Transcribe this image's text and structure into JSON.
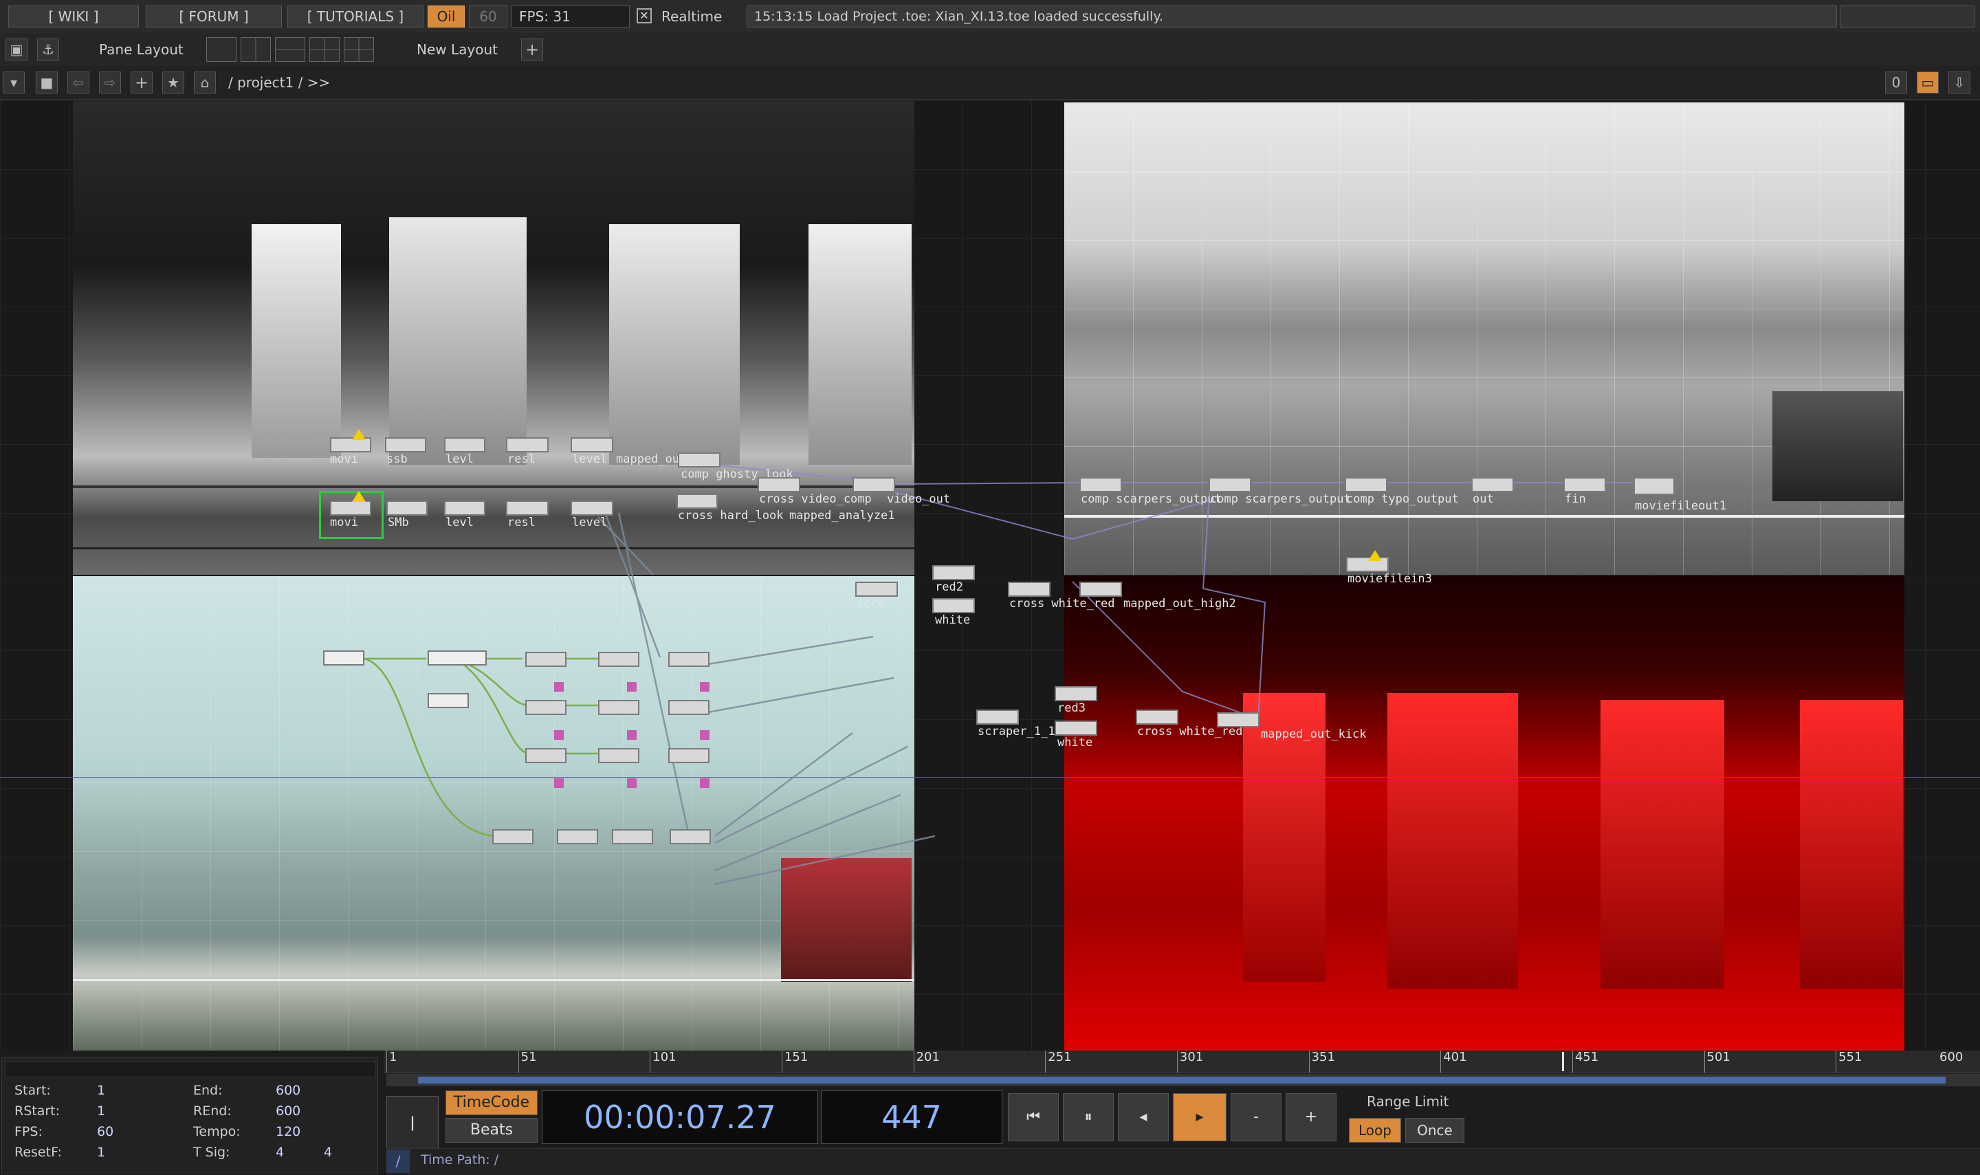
{
  "topbar": {
    "wiki": "[ WIKI ]",
    "forum": "[ FORUM ]",
    "tutorials": "[ TUTORIALS ]",
    "oil": "Oil",
    "sixty": "60",
    "fps": "FPS:  31",
    "realtime": "Realtime",
    "status": "15:13:15 Load Project .toe: Xian_XI.13.toe loaded successfully."
  },
  "row2": {
    "pane_layout": "Pane Layout",
    "new_layout": "New Layout"
  },
  "row3": {
    "path": "/ project1  / >>",
    "counter": "0"
  },
  "nodes": {
    "r1": [
      "movi",
      "ssb",
      "levl",
      "resl",
      "level"
    ],
    "r2": [
      "movi",
      "SMb",
      "levl",
      "resl",
      "level"
    ],
    "mapped_out_high": "mapped_out_high",
    "comp_ghosty": "comp  ghosty_look",
    "cross_video": "cross  video_comp",
    "video_out": "video_out",
    "cross_hard": "cross  hard_look",
    "mapped_analyze": "mapped_analyze1",
    "comp_scarpers1": "comp  scarpers_output",
    "scarpers_output2": "comp  scarpers_output",
    "comp_typo": "comp  typo_output",
    "out": "out",
    "fin": "fin",
    "moviefileout1": "moviefileout1",
    "moviefilein3": "moviefilein3",
    "red2": "red2",
    "white1": "white",
    "cross_white1": "cross  white_red",
    "mapped_out_high2": "mapped_out_high2",
    "scra": "scra",
    "red3": "red3",
    "white2": "white",
    "scraper": "scraper_1_1",
    "cross_white2": "cross  white_red",
    "mapped_out_kick": "mapped_out_kick"
  },
  "info": {
    "start_k": "Start:",
    "start_v": "1",
    "end_k": "End:",
    "end_v": "600",
    "rstart_k": "RStart:",
    "rstart_v": "1",
    "rend_k": "REnd:",
    "rend_v": "600",
    "fps_k": "FPS:",
    "fps_v": "60",
    "tempo_k": "Tempo:",
    "tempo_v": "120",
    "resetf_k": "ResetF:",
    "resetf_v": "1",
    "tsig_k": "T Sig:",
    "tsig_a": "4",
    "tsig_b": "4"
  },
  "timeline": {
    "ticks": [
      "1",
      "51",
      "101",
      "151",
      "201",
      "251",
      "301",
      "351",
      "401",
      "451",
      "501",
      "551",
      "600"
    ],
    "playhead_frame": 447
  },
  "transport": {
    "timecode": "TimeCode",
    "beats": "Beats",
    "time": "00:00:07.27",
    "frame": "447",
    "range_limit": "Range Limit",
    "loop": "Loop",
    "once": "Once",
    "minus": "-",
    "plus": "+",
    "time_path": "Time Path: /",
    "slash": "/"
  },
  "colors": {
    "accent": "#d98a3a",
    "timecode_text": "#8fb4ff",
    "selected_node": "#2ecc40"
  }
}
